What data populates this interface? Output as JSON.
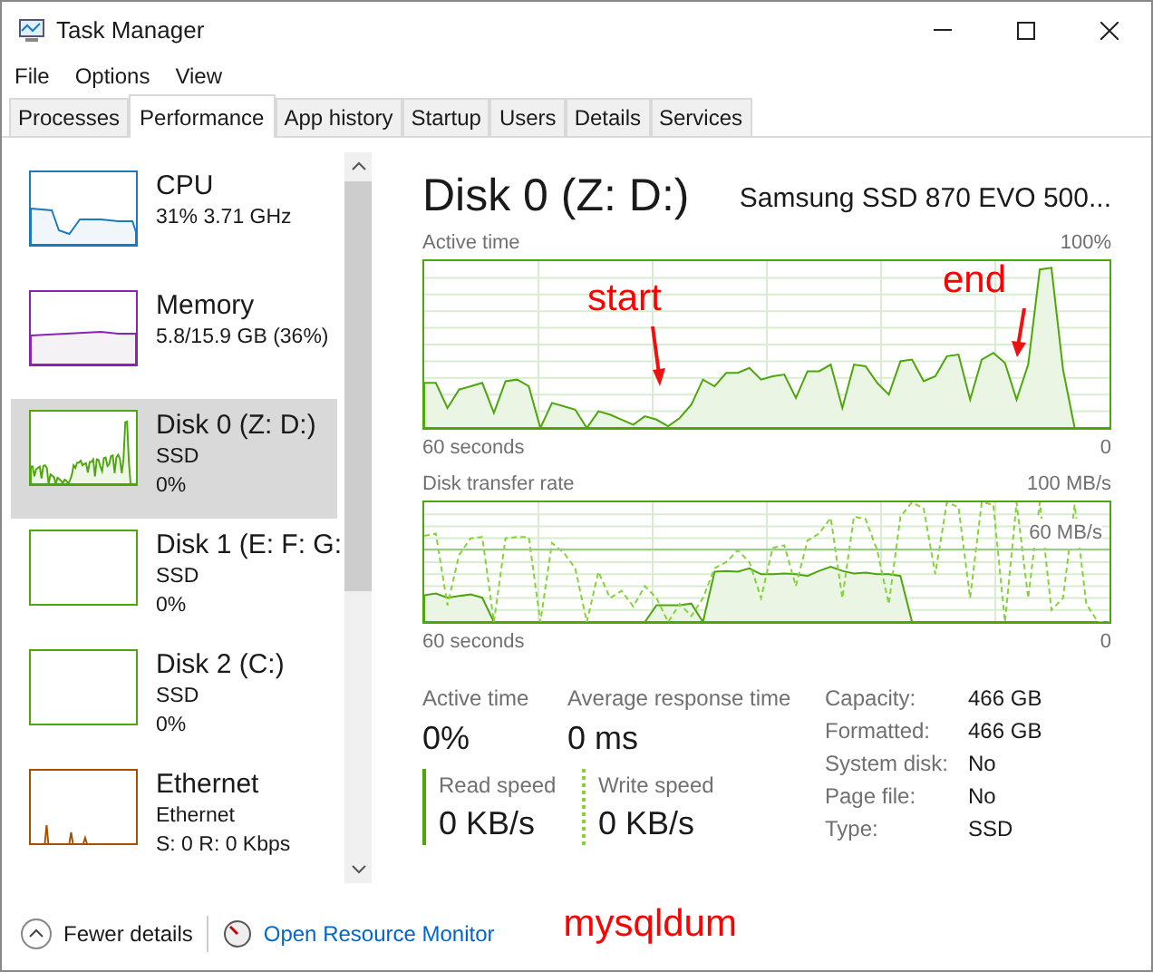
{
  "window": {
    "title": "Task Manager"
  },
  "menu": [
    "File",
    "Options",
    "View"
  ],
  "tabs": [
    {
      "label": "Processes",
      "selected": false
    },
    {
      "label": "Performance",
      "selected": true
    },
    {
      "label": "App history",
      "selected": false
    },
    {
      "label": "Startup",
      "selected": false
    },
    {
      "label": "Users",
      "selected": false
    },
    {
      "label": "Details",
      "selected": false
    },
    {
      "label": "Services",
      "selected": false
    }
  ],
  "sidebar": {
    "items": [
      {
        "name": "CPU",
        "lines": [
          "31% 3.71 GHz"
        ],
        "color": "#1a7ac0",
        "selected": false
      },
      {
        "name": "Memory",
        "lines": [
          "5.8/15.9 GB (36%)"
        ],
        "color": "#8b22b3",
        "selected": false
      },
      {
        "name": "Disk 0 (Z: D:)",
        "lines": [
          "SSD",
          "0%"
        ],
        "color": "#4da60c",
        "selected": true
      },
      {
        "name": "Disk 1 (E: F: G:",
        "lines": [
          "SSD",
          "0%"
        ],
        "color": "#4da60c",
        "selected": false
      },
      {
        "name": "Disk 2 (C:)",
        "lines": [
          "SSD",
          "0%"
        ],
        "color": "#4da60c",
        "selected": false
      },
      {
        "name": "Ethernet",
        "lines": [
          "Ethernet",
          "S: 0 R: 0 Kbps"
        ],
        "color": "#a74f01",
        "selected": false
      }
    ]
  },
  "detail": {
    "title": "Disk 0 (Z: D:)",
    "model": "Samsung SSD 870 EVO 500...",
    "active_chart": {
      "label": "Active time",
      "max": "100%",
      "duration": "60 seconds",
      "min": "0"
    },
    "transfer_chart": {
      "label": "Disk transfer rate",
      "max": "100 MB/s",
      "marker": "60 MB/s",
      "duration": "60 seconds",
      "min": "0"
    },
    "stats": [
      {
        "label": "Active time",
        "value": "0%"
      },
      {
        "label": "Average response time",
        "value": "0 ms"
      }
    ],
    "speeds": [
      {
        "kind": "read",
        "label": "Read speed",
        "value": "0 KB/s"
      },
      {
        "kind": "write",
        "label": "Write speed",
        "value": "0 KB/s"
      }
    ],
    "properties": [
      {
        "label": "Capacity:",
        "value": "466 GB"
      },
      {
        "label": "Formatted:",
        "value": "466 GB"
      },
      {
        "label": "System disk:",
        "value": "No"
      },
      {
        "label": "Page file:",
        "value": "No"
      },
      {
        "label": "Type:",
        "value": "SSD"
      }
    ]
  },
  "annotations": {
    "start": "start",
    "end": "end",
    "note": "mysqldum"
  },
  "footer": {
    "fewer": "Fewer details",
    "monitor": "Open Resource Monitor"
  }
}
